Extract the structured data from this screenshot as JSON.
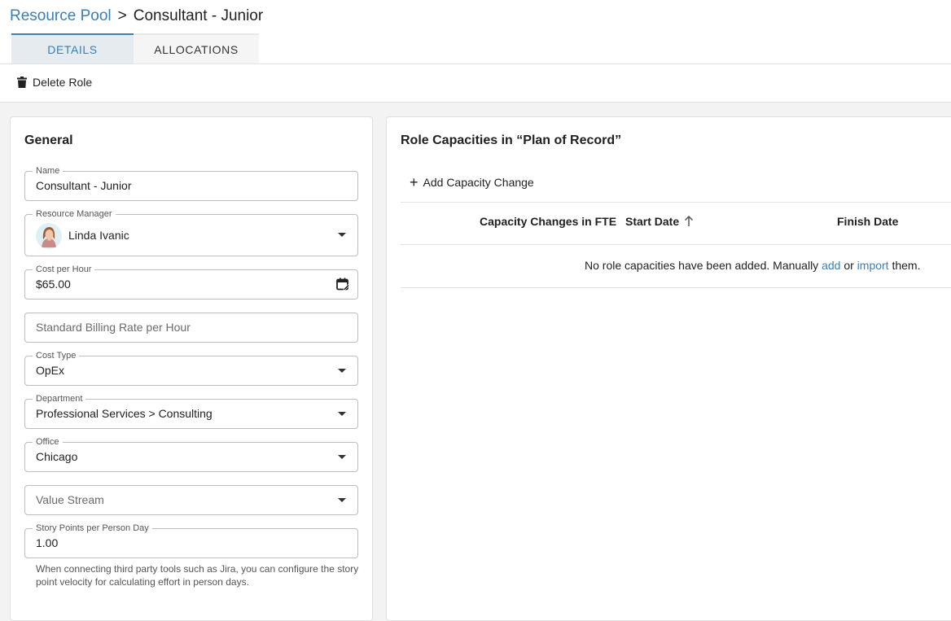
{
  "breadcrumb": {
    "parent": "Resource Pool",
    "separator": ">",
    "current": "Consultant - Junior"
  },
  "tabs": [
    {
      "label": "DETAILS",
      "active": true
    },
    {
      "label": "ALLOCATIONS",
      "active": false
    }
  ],
  "toolbar": {
    "delete_label": "Delete Role",
    "delete_icon": "trash-icon"
  },
  "general": {
    "title": "General",
    "name": {
      "label": "Name",
      "value": "Consultant - Junior"
    },
    "resource_manager": {
      "label": "Resource Manager",
      "value": "Linda Ivanic"
    },
    "cost_per_hour": {
      "label": "Cost per Hour",
      "value": "$65.00"
    },
    "billing_rate": {
      "placeholder": "Standard Billing Rate per Hour"
    },
    "cost_type": {
      "label": "Cost Type",
      "value": "OpEx"
    },
    "department": {
      "label": "Department",
      "value": "Professional Services > Consulting"
    },
    "office": {
      "label": "Office",
      "value": "Chicago"
    },
    "value_stream": {
      "placeholder": "Value Stream"
    },
    "story_points": {
      "label": "Story Points per Person Day",
      "value": "1.00"
    },
    "helper_text": "When connecting third party tools such as Jira, you can configure the story point velocity for calculating effort in person days."
  },
  "capacities": {
    "title": "Role Capacities in “Plan of Record”",
    "add_label": "Add Capacity Change",
    "columns": [
      "Capacity Changes in FTE",
      "Start Date",
      "Finish Date"
    ],
    "sort_column": "Start Date",
    "sort_direction": "ascending",
    "empty": {
      "prefix": "No role capacities have been added. Manually ",
      "add_link": "add",
      "middle": " or ",
      "import_link": "import",
      "suffix": " them."
    }
  },
  "colors": {
    "accent": "#3a7fb5",
    "tab_active_bg": "#e6ebef",
    "background": "#f3f3f3"
  }
}
